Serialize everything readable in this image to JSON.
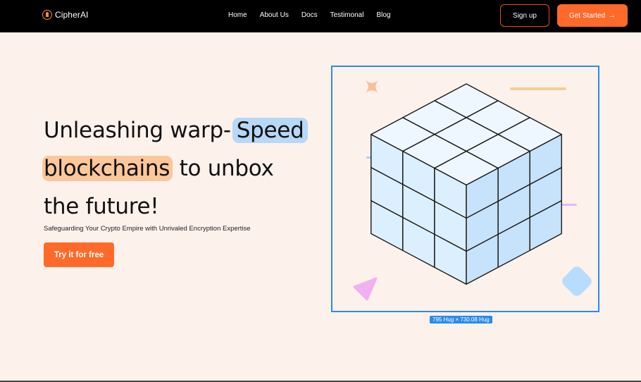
{
  "nav": {
    "logo_text": "CipherAI",
    "links": [
      "Home",
      "About Us",
      "Docs",
      "Testimonal",
      "Blog"
    ],
    "signup_label": "Sign up",
    "get_started_label": "Get Started",
    "get_started_icon": "arrow-right-icon"
  },
  "hero": {
    "line1_prefix": "Unleashing warp-",
    "line1_highlight": "Speed",
    "line2_highlight": "blockchains",
    "line2_suffix": " to unbox",
    "line3": "the future!",
    "subtitle": "Safeguarding Your Crypto Empire with Unrivaled Encryption Expertise",
    "cta_label": "Try it for free"
  },
  "selection": {
    "badge": "795 Hug × 730.08 Hug"
  },
  "colors": {
    "accent": "#ff6a2a",
    "highlight_blue": "#b7d8f6",
    "highlight_orange": "#fcc79a",
    "selection_blue": "#2a8bea",
    "background": "#fdf1ec"
  }
}
